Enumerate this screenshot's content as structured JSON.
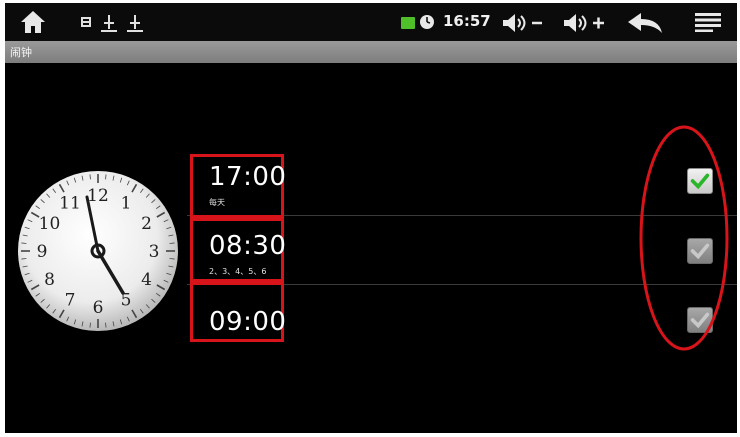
{
  "status_bar": {
    "time": "16:57",
    "battery_color": "#4fbf2a",
    "icons": [
      "home-icon",
      "notification-icon",
      "usb-icon",
      "usb-icon",
      "battery-icon",
      "alarm-icon",
      "volume-down-icon",
      "volume-up-icon",
      "back-icon",
      "menu-icon"
    ]
  },
  "title_bar": {
    "title": "闹钟"
  },
  "alarms": [
    {
      "time": "17:00",
      "days": "每天",
      "enabled": true
    },
    {
      "time": "08:30",
      "days": "2、3、4、5、6",
      "enabled": false
    },
    {
      "time": "09:00",
      "days": "",
      "enabled": false
    }
  ],
  "clock": {
    "numerals": [
      "12",
      "1",
      "2",
      "3",
      "4",
      "5",
      "6",
      "7",
      "8",
      "9",
      "10",
      "11"
    ]
  },
  "colors": {
    "highlight": "#d8141b",
    "check": "#2bb52b"
  }
}
